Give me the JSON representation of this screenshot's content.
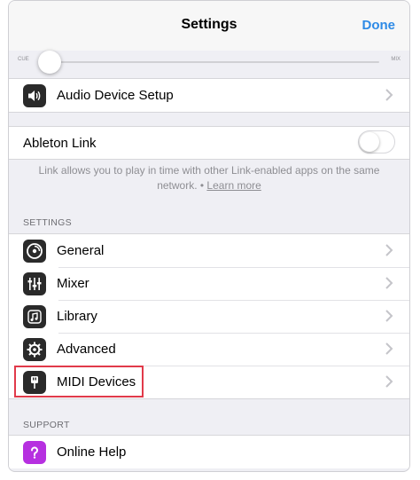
{
  "navbar": {
    "title": "Settings",
    "done_label": "Done"
  },
  "crossfader": {
    "left_label": "CUE",
    "right_label": "MIX"
  },
  "audio_group": {
    "audio_device_label": "Audio Device Setup"
  },
  "link_group": {
    "label": "Ableton Link",
    "enabled": false,
    "description": "Link allows you to play in time with other Link-enabled apps on the same network.",
    "separator": " • ",
    "learn_more": "Learn more"
  },
  "settings_section": {
    "header": "SETTINGS",
    "items": [
      {
        "label": "General",
        "icon": "disc-icon"
      },
      {
        "label": "Mixer",
        "icon": "mixer-icon"
      },
      {
        "label": "Library",
        "icon": "music-note-icon"
      },
      {
        "label": "Advanced",
        "icon": "gear-icon"
      },
      {
        "label": "MIDI Devices",
        "icon": "midi-plug-icon"
      }
    ]
  },
  "support_section": {
    "header": "SUPPORT",
    "items": [
      {
        "label": "Online Help",
        "icon": "question-icon"
      }
    ]
  },
  "colors": {
    "accent": "#2d8ae6",
    "highlight": "#e13a4a",
    "help_icon": "#b630e0"
  }
}
